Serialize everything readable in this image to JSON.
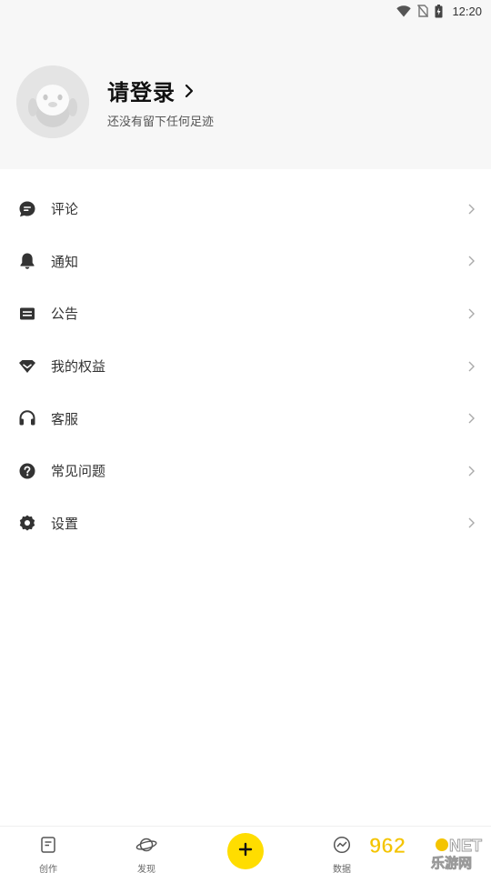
{
  "status_bar": {
    "time": "12:20",
    "icons": [
      "wifi-icon",
      "no-sim-icon",
      "battery-charging-icon"
    ]
  },
  "profile": {
    "title": "请登录",
    "subtitle": "还没有留下任何足迹",
    "avatar_icon": "penguin-avatar-icon"
  },
  "menu": {
    "items": [
      {
        "label": "评论",
        "icon": "comment-icon"
      },
      {
        "label": "通知",
        "icon": "bell-icon"
      },
      {
        "label": "公告",
        "icon": "announcement-icon"
      },
      {
        "label": "我的权益",
        "icon": "diamond-icon"
      },
      {
        "label": "客服",
        "icon": "headset-icon"
      },
      {
        "label": "常见问题",
        "icon": "question-icon"
      },
      {
        "label": "设置",
        "icon": "gear-icon"
      }
    ]
  },
  "bottom_nav": {
    "items": [
      {
        "label": "创作",
        "icon": "document-icon"
      },
      {
        "label": "发现",
        "icon": "planet-icon"
      },
      {
        "label": "",
        "icon": "add-icon"
      },
      {
        "label": "数据",
        "icon": "chart-icon"
      }
    ],
    "accent_color": "#ffdd00"
  },
  "watermark": {
    "text_number": "962",
    "text_net": "NET",
    "text_site": "乐游网"
  }
}
